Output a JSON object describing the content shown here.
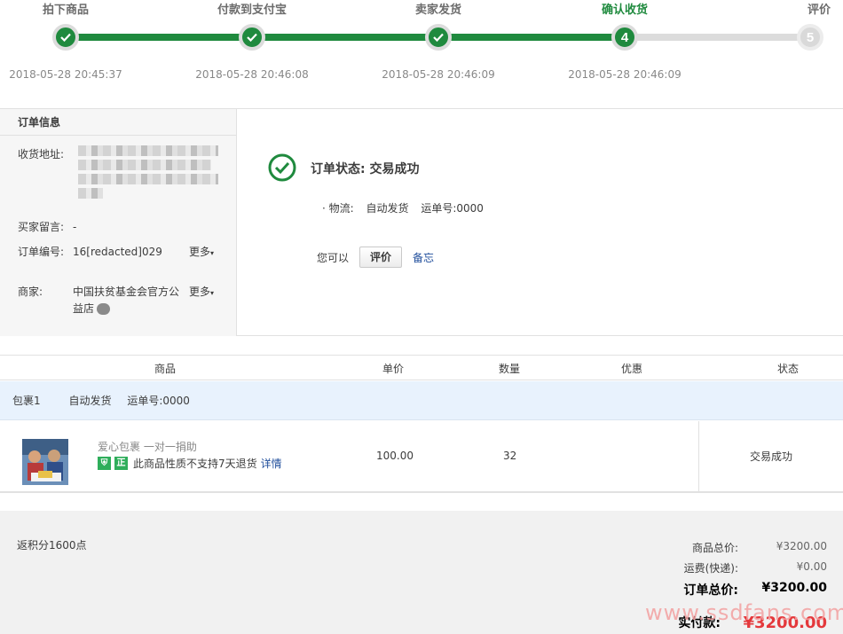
{
  "steps": [
    {
      "title": "拍下商品",
      "time": "2018-05-28 20:45:37",
      "state": "done"
    },
    {
      "title": "付款到支付宝",
      "time": "2018-05-28 20:46:08",
      "state": "done"
    },
    {
      "title": "卖家发货",
      "time": "2018-05-28 20:46:09",
      "state": "done"
    },
    {
      "title": "确认收货",
      "time": "2018-05-28 20:46:09",
      "state": "current",
      "number": "4"
    },
    {
      "title": "评价",
      "time": "",
      "state": "todo",
      "number": "5"
    }
  ],
  "order_info": {
    "title": "订单信息",
    "address_label": "收货地址:",
    "message_label": "买家留言:",
    "message_value": "-",
    "order_no_label": "订单编号:",
    "order_no_value": "16[redacted]029",
    "more_label": "更多",
    "seller_label": "商家:",
    "seller_value": "中国扶贫基金会官方公益店"
  },
  "status": {
    "text": "订单状态: 交易成功",
    "logistics_label": "· 物流:",
    "logistics_method": "自动发货",
    "tracking": "运单号:0000",
    "you_can": "您可以",
    "review_button": "评价",
    "note_link": "备忘"
  },
  "table": {
    "headers": [
      "商品",
      "单价",
      "数量",
      "优惠",
      "状态"
    ],
    "package": {
      "name": "包裹1",
      "method": "自动发货",
      "tracking": "运单号:0000"
    },
    "item": {
      "name": "爱心包裹 一对一捐助",
      "badge_icon": "shield-icon",
      "badge_text": "正",
      "no_return_text": "此商品性质不支持7天退货",
      "detail_link": "详情",
      "price": "100.00",
      "quantity": "32",
      "discount": "",
      "state": "交易成功"
    }
  },
  "summary": {
    "points": "返积分1600点",
    "goods_total_label": "商品总价:",
    "goods_total_value": "¥3200.00",
    "shipping_label": "运费(快递):",
    "shipping_value": "¥0.00",
    "order_total_label": "订单总价:",
    "order_total_value": "¥3200.00",
    "paid_label": "实付款:",
    "paid_value": "¥3200.00"
  },
  "watermark": "www.ssdfans.com",
  "colors": {
    "accent": "#1f8a3e",
    "link": "#1f4d9b",
    "price": "#e4393c",
    "package_bg": "#e8f2fd"
  }
}
